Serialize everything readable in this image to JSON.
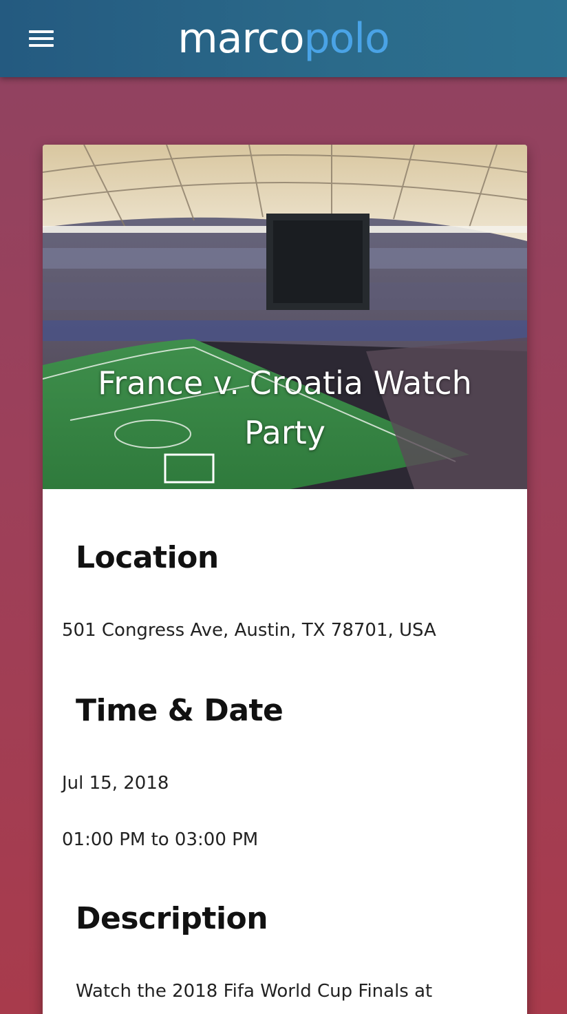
{
  "navbar": {
    "logo_part1": "marco",
    "logo_part2": "polo",
    "menu_icon": "hamburger-menu-icon"
  },
  "colors": {
    "nav_bg": "#2b6a8a",
    "logo_accent": "#4aa3e6",
    "page_bg": "#9c405a"
  },
  "event": {
    "title": "France v. Croatia Watch Party",
    "location_heading": "Location",
    "address": "501 Congress Ave, Austin, TX 78701, USA",
    "time_heading": "Time & Date",
    "date": "Jul 15, 2018",
    "time_range": "01:00 PM to 03:00 PM",
    "description_heading": "Description",
    "description": "Watch the 2018 Fifa World Cup Finals at"
  }
}
